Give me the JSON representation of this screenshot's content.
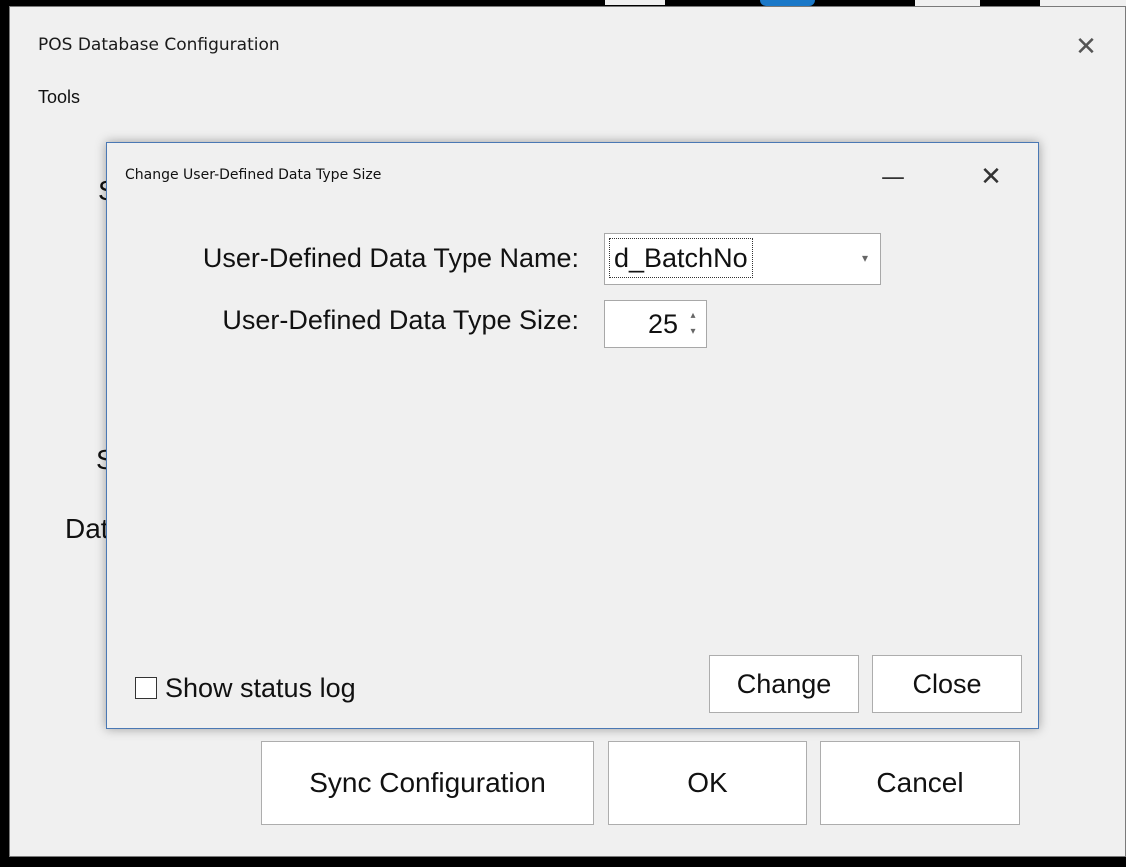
{
  "main_window": {
    "title": "POS Database Configuration",
    "close_icon": "✕",
    "menu": {
      "tools": "Tools"
    },
    "partial_labels": [
      "S",
      "S",
      "Dat"
    ],
    "buttons": {
      "sync": "Sync Configuration",
      "ok": "OK",
      "cancel": "Cancel"
    }
  },
  "dialog": {
    "title": "Change User-Defined Data Type Size",
    "minimize_icon": "—",
    "close_icon": "✕",
    "name_label": "User-Defined Data Type Name:",
    "name_value": "d_BatchNo",
    "name_dropdown_icon": "▾",
    "size_label": "User-Defined Data Type Size:",
    "size_value": "25",
    "spin_up_icon": "▴",
    "spin_down_icon": "▾",
    "show_status_log": {
      "label": "Show status log",
      "checked": false
    },
    "buttons": {
      "change": "Change",
      "close": "Close"
    }
  }
}
